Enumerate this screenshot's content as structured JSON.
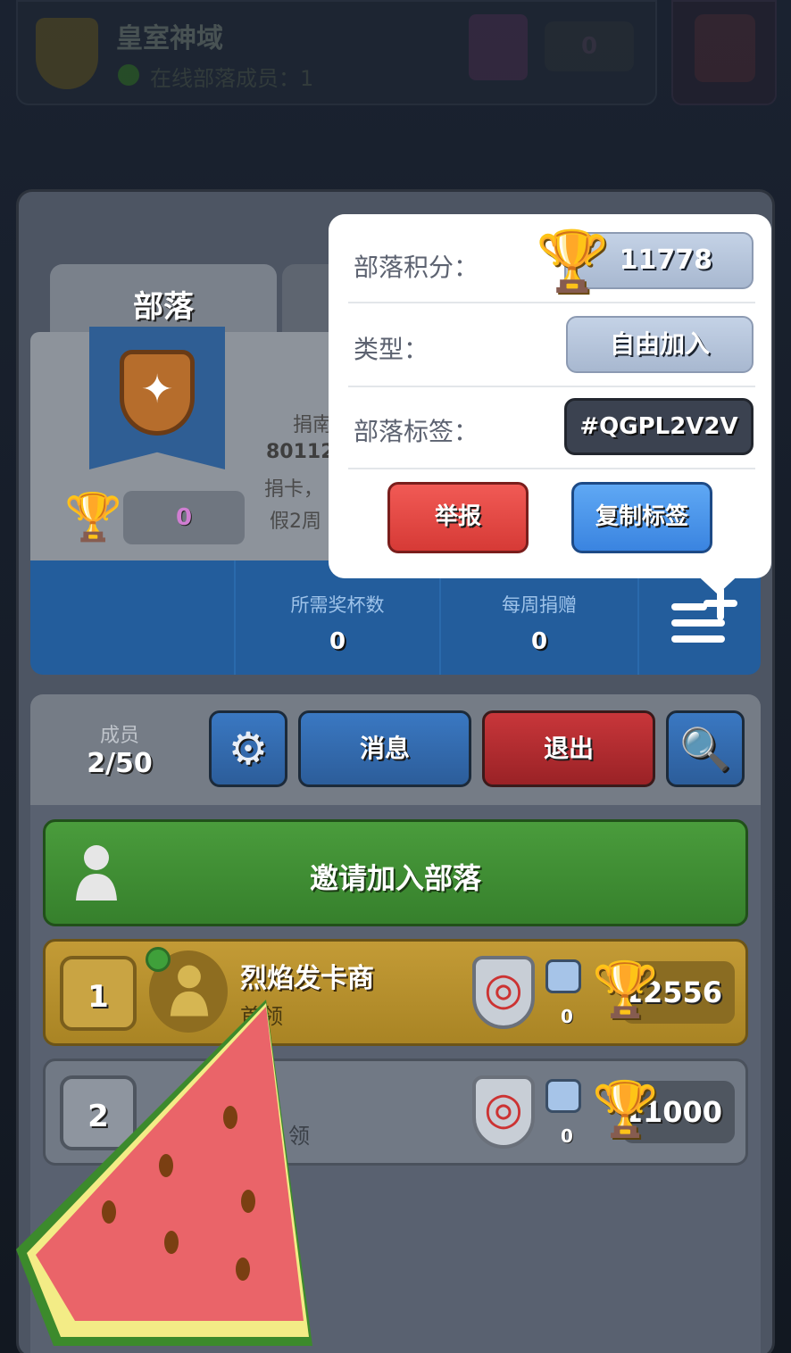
{
  "header": {
    "clan_name": "皇室神域",
    "online_text": "在线部落成员：1",
    "trophy_value": "0"
  },
  "tabs": [
    {
      "label": "部落"
    }
  ],
  "clan_info": {
    "trophy_value": "0",
    "desc_line1": "捐南",
    "desc_line2": "80112",
    "desc_line3": "捐卡，",
    "desc_line4": "假2周"
  },
  "stats": {
    "required_trophies_label": "所需奖杯数",
    "required_trophies_value": "0",
    "weekly_donations_label": "每周捐赠",
    "weekly_donations_value": "0"
  },
  "members": {
    "label": "成员",
    "count": "2/50",
    "buttons": {
      "message": "消息",
      "leave": "退出"
    }
  },
  "invite": {
    "label": "邀请加入部落"
  },
  "member_list": [
    {
      "rank": "1",
      "name": "烈焰发卡商",
      "role": "首领",
      "donations": "0",
      "trophies": "12556"
    },
    {
      "rank": "2",
      "name": "",
      "role": "领",
      "donations": "0",
      "trophies": "11000"
    }
  ],
  "popup": {
    "clan_score_label": "部落积分：",
    "clan_score_value": "11778",
    "type_label": "类型：",
    "type_value": "自由加入",
    "tag_label": "部落标签：",
    "tag_value": "#QGPL2V2V",
    "report_button": "举报",
    "copy_tag_button": "复制标签"
  },
  "colors": {
    "panel": "#4d5563",
    "stats_blue": "#235d9c",
    "invite_green": "#3f8e33",
    "gold_row": "#b99130",
    "report_red": "#e34a46",
    "copy_blue": "#4b96ea"
  }
}
